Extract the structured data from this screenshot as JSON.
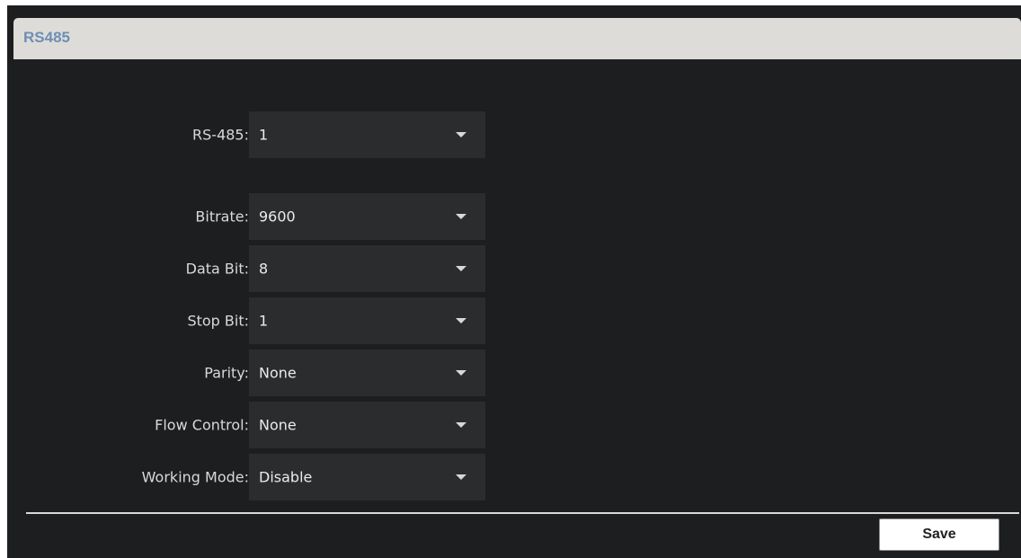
{
  "panel": {
    "title": "RS485"
  },
  "form": {
    "rows": [
      {
        "label": "RS-485:",
        "value": "1"
      },
      {
        "label": "Bitrate:",
        "value": "9600"
      },
      {
        "label": "Data Bit:",
        "value": "8"
      },
      {
        "label": "Stop Bit:",
        "value": "1"
      },
      {
        "label": "Parity:",
        "value": "None"
      },
      {
        "label": "Flow Control:",
        "value": "None"
      },
      {
        "label": "Working Mode:",
        "value": "Disable"
      }
    ]
  },
  "footer": {
    "save_label": "Save"
  },
  "icons": {
    "dropdown": "chevron-down-icon"
  },
  "colors": {
    "background": "#1d1e20",
    "title_bar": "#dedcd8",
    "title_text": "#6e8fb4",
    "select_bg": "#2b2c2e"
  }
}
